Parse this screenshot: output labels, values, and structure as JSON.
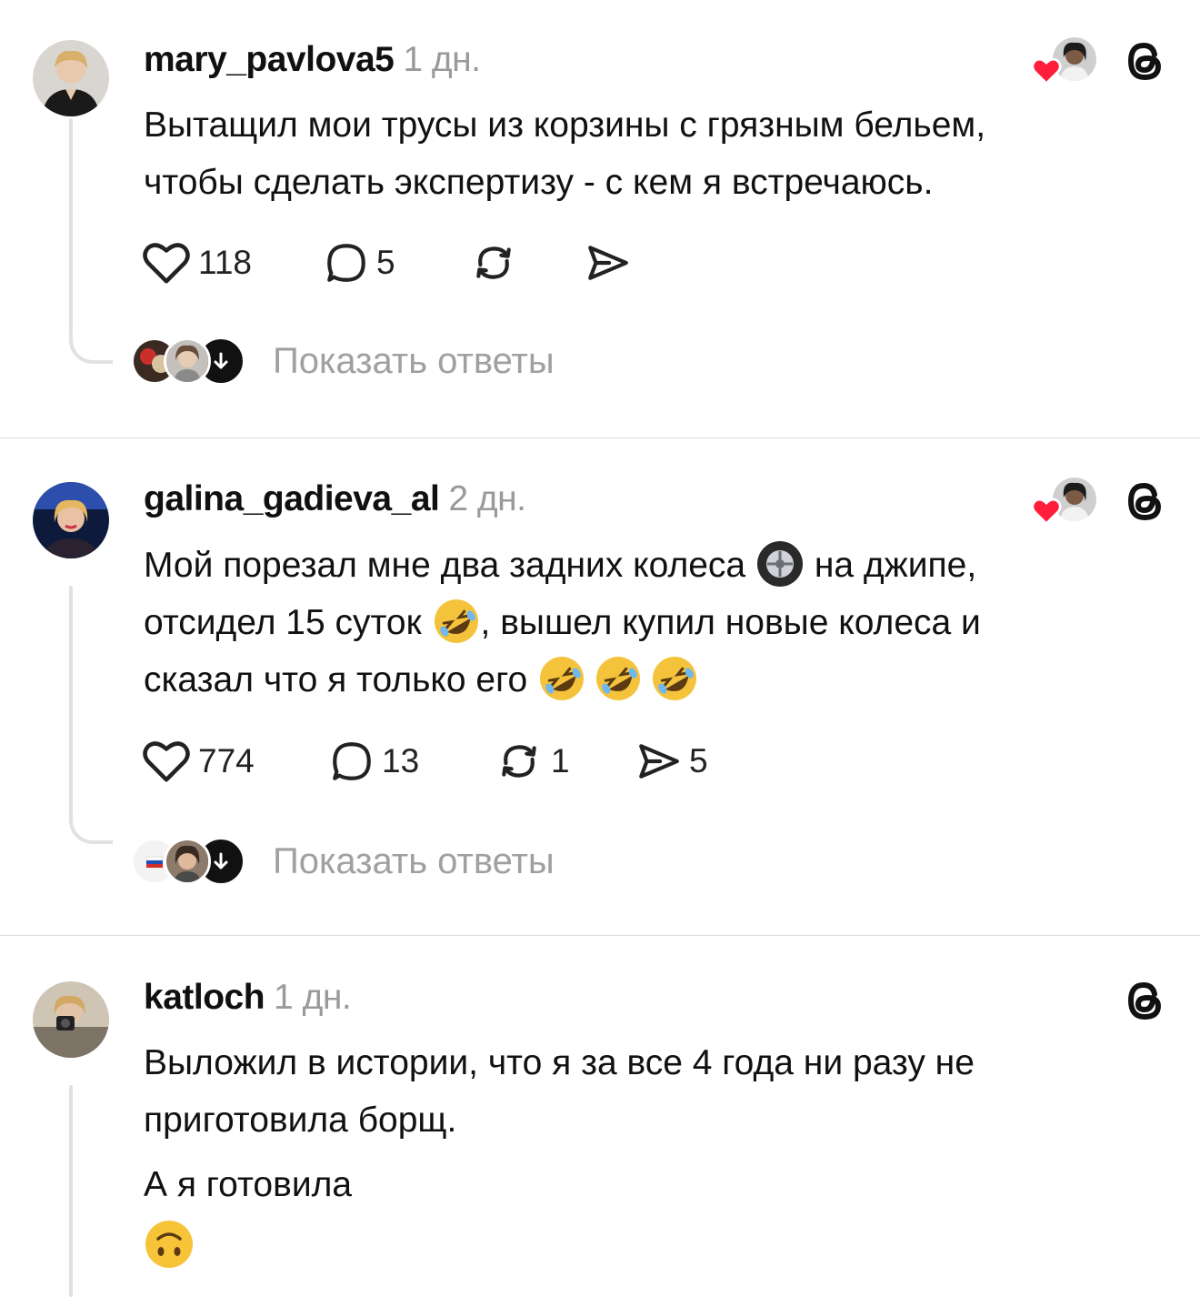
{
  "posts": [
    {
      "username": "mary_pavlova5",
      "time": "1 дн.",
      "text_lines": [
        "Вытащил мои трусы из корзины с грязным бельем,",
        "чтобы сделать экспертизу - с кем я встречаюсь."
      ],
      "likes": "118",
      "comments": "5",
      "reposts": "",
      "shares": "",
      "show_replies": "Показать ответы",
      "liked_by_author": true
    },
    {
      "username": "galina_gadieva_al",
      "time": "2 дн.",
      "text_line1_a": "Мой порезал мне два задних колеса",
      "text_line1_emoji": "wheel-emoji",
      "text_line1_b": "на джипе,",
      "text_line2_a": "отсидел 15 суток",
      "text_line2_emoji": "rofl-emoji",
      "text_line2_b": ", вышел купил новые колеса и",
      "text_line3": "сказал что я только его",
      "text_line3_emojis": [
        "rofl-emoji",
        "rofl-emoji",
        "rofl-emoji"
      ],
      "likes": "774",
      "comments": "13",
      "reposts": "1",
      "shares": "5",
      "show_replies": "Показать ответы",
      "liked_by_author": true
    },
    {
      "username": "katloch",
      "time": "1 дн.",
      "text_lines": [
        "Выложил в истории, что я за все 4 года ни разу не",
        "приготовила борщ.",
        "А я готовила"
      ],
      "text_emoji": "upside-down-face-emoji",
      "liked_by_author": false
    }
  ],
  "icons": {
    "like": "heart-outline-icon",
    "comment": "comment-bubble-icon",
    "repost": "repost-arrows-icon",
    "share": "send-paper-plane-icon",
    "threads": "threads-logo-icon",
    "expand": "arrow-down-icon"
  },
  "colors": {
    "heart_red": "#ff1e3c",
    "muted_text": "#9a9a9a",
    "thread_line": "#e1e1e1"
  }
}
